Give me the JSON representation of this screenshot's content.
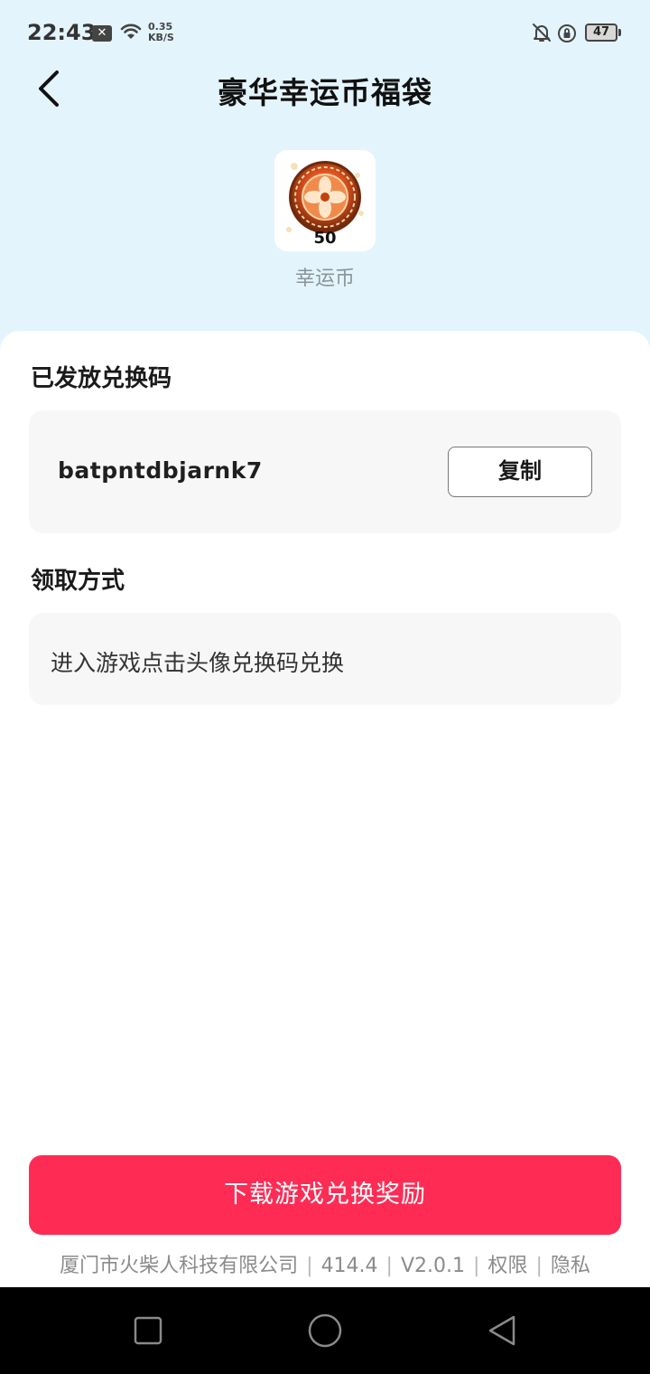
{
  "status_bar": {
    "time": "22:43",
    "notification_icon": "x-icon",
    "net_speed_value": "0.35",
    "net_speed_unit": "KB/S",
    "battery": "47"
  },
  "header": {
    "title": "豪华幸运币福袋",
    "back_icon": "chevron-left-icon"
  },
  "reward": {
    "icon": "lucky-coin-icon",
    "count": "50",
    "name": "幸运币"
  },
  "code_section": {
    "title": "已发放兑换码",
    "code": "batpntdbjarnk7",
    "copy_label": "复制"
  },
  "method_section": {
    "title": "领取方式",
    "description": "进入游戏点击头像兑换码兑换"
  },
  "download_button": {
    "label": "下载游戏兑换奖励",
    "color": "#fe2c55"
  },
  "footer": {
    "company": "厦门市火柴人科技有限公司",
    "size": "414.4",
    "version": "V2.0.1",
    "permissions": "权限",
    "privacy": "隐私",
    "separator": "|"
  },
  "colors": {
    "header_bg": "#e3f4fc",
    "card_bg": "#ffffff",
    "box_bg": "#f7f7f7"
  }
}
